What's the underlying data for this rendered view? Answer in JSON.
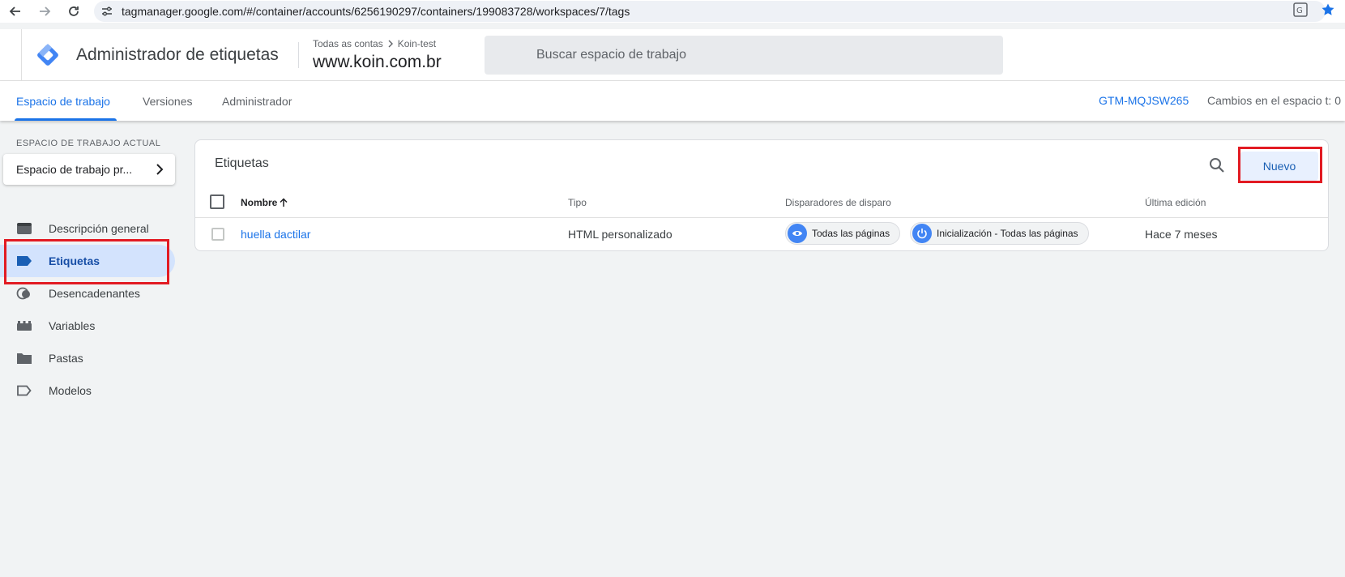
{
  "browser": {
    "url": "tagmanager.google.com/#/container/accounts/6256190297/containers/199083728/workspaces/7/tags"
  },
  "header": {
    "app_title": "Administrador de etiquetas",
    "breadcrumb_account": "Todas as contas",
    "breadcrumb_container": "Koin-test",
    "container_name": "www.koin.com.br",
    "search_placeholder": "Buscar espacio de trabajo"
  },
  "tabs": [
    {
      "label": "Espacio de trabajo",
      "active": true
    },
    {
      "label": "Versiones",
      "active": false
    },
    {
      "label": "Administrador",
      "active": false
    }
  ],
  "container_id": "GTM-MQJSW265",
  "workspace_changes": "Cambios en el espacio t: 0",
  "sidebar": {
    "current_workspace_heading": "ESPACIO DE TRABAJO ACTUAL",
    "current_workspace": "Espacio de trabajo pr...",
    "items": [
      {
        "label": "Descripción general",
        "icon": "overview-icon",
        "active": false
      },
      {
        "label": "Etiquetas",
        "icon": "tag-icon",
        "active": true
      },
      {
        "label": "Desencadenantes",
        "icon": "trigger-icon",
        "active": false
      },
      {
        "label": "Variables",
        "icon": "variables-icon",
        "active": false
      },
      {
        "label": "Pastas",
        "icon": "folder-icon",
        "active": false
      },
      {
        "label": "Modelos",
        "icon": "template-icon",
        "active": false
      }
    ]
  },
  "tags_table": {
    "title": "Etiquetas",
    "new_button": "Nuevo",
    "columns": [
      "Nombre",
      "Tipo",
      "Disparadores de disparo",
      "Última edición"
    ],
    "rows": [
      {
        "name": "huella dactilar",
        "type": "HTML personalizado",
        "triggers": [
          "Todas las páginas",
          "Inicialización - Todas las páginas"
        ],
        "last_edited": "Hace 7 meses"
      }
    ]
  },
  "colors": {
    "accent": "#1a73e8",
    "highlight_box": "#e21b23",
    "active_nav": "#d3e3fd"
  }
}
